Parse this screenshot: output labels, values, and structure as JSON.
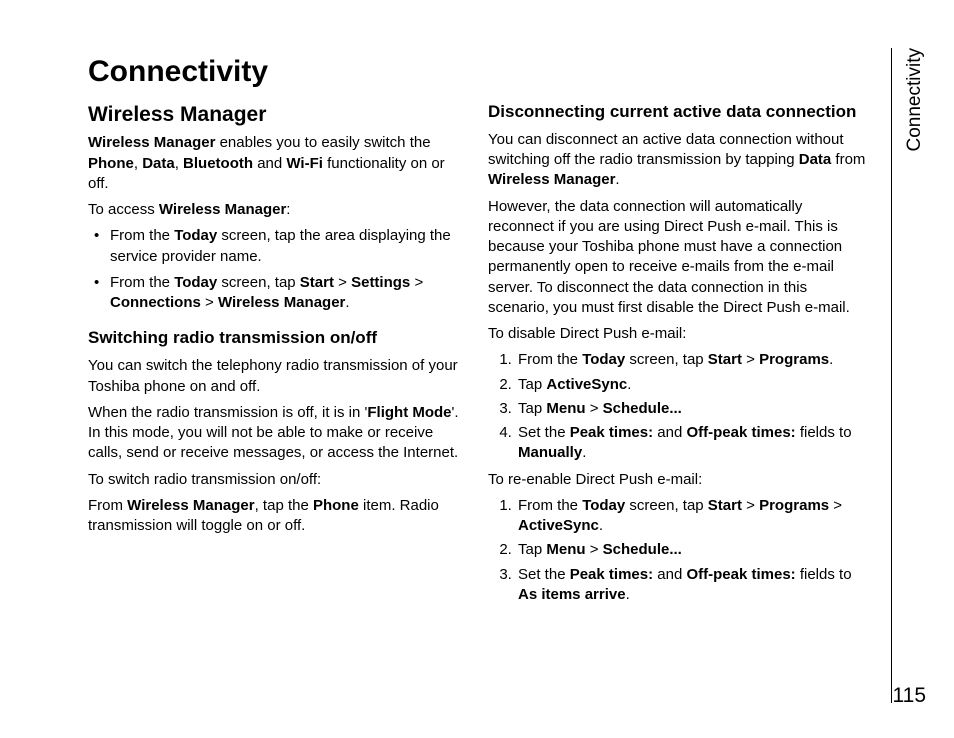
{
  "title": "Connectivity",
  "sideTab": "Connectivity",
  "pageNumber": "115",
  "left": {
    "h2": "Wireless Manager",
    "intro_1a": "Wireless Manager",
    "intro_1b": " enables you to easily switch the ",
    "intro_1c": "Phone",
    "intro_1d": ", ",
    "intro_1e": "Data",
    "intro_1f": ", ",
    "intro_1g": "Bluetooth",
    "intro_1h": " and ",
    "intro_1i": "Wi-Fi",
    "intro_1j": " functionality on or off.",
    "access_1a": "To access ",
    "access_1b": "Wireless Manager",
    "access_1c": ":",
    "bul1_a": "From the ",
    "bul1_b": "Today",
    "bul1_c": " screen, tap the area displaying the service provider name.",
    "bul2_a": "From the ",
    "bul2_b": "Today",
    "bul2_c": " screen, tap ",
    "bul2_d": "Start",
    "bul2_e": " > ",
    "bul2_f": "Settings",
    "bul2_g": " > ",
    "bul2_h": "Connections",
    "bul2_i": " > ",
    "bul2_j": "Wireless Manager",
    "bul2_k": ".",
    "h3a": "Switching radio transmission on/off",
    "p3": "You can switch the telephony radio transmission of your Toshiba phone on and off.",
    "p4a": "When the radio transmission is off, it is in '",
    "p4b": "Flight Mode",
    "p4c": "'. In this mode, you will not be able to make or receive calls, send or receive messages, or access the Internet.",
    "p5": "To switch radio transmission on/off:",
    "p6a": "From ",
    "p6b": "Wireless Manager",
    "p6c": ", tap the ",
    "p6d": "Phone",
    "p6e": " item. Radio transmission will toggle on or off."
  },
  "right": {
    "h3b": "Disconnecting current active data connection",
    "p1a": "You can disconnect an active data connection without switching off the radio transmission by tapping ",
    "p1b": "Data",
    "p1c": " from ",
    "p1d": "Wireless Manager",
    "p1e": ".",
    "p2": "However, the data connection will automatically reconnect if you are using Direct Push e-mail. This is because your Toshiba phone must have a connection permanently open to receive e-mails from the e-mail server. To disconnect the data connection in this scenario, you must first disable the Direct Push e-mail.",
    "p3": "To disable Direct Push e-mail:",
    "d1_a": "From the ",
    "d1_b": "Today",
    "d1_c": " screen, tap ",
    "d1_d": "Start",
    "d1_e": " > ",
    "d1_f": "Programs",
    "d1_g": ".",
    "d2_a": "Tap ",
    "d2_b": "ActiveSync",
    "d2_c": ".",
    "d3_a": "Tap ",
    "d3_b": "Menu",
    "d3_c": " > ",
    "d3_d": "Schedule...",
    "d4_a": "Set the ",
    "d4_b": "Peak times:",
    "d4_c": " and ",
    "d4_d": "Off-peak times:",
    "d4_e": " fields to ",
    "d4_f": "Manually",
    "d4_g": ".",
    "p4": "To re-enable Direct Push e-mail:",
    "r1_a": "From the ",
    "r1_b": "Today",
    "r1_c": " screen, tap ",
    "r1_d": "Start",
    "r1_e": " > ",
    "r1_f": "Programs",
    "r1_g": " > ",
    "r1_h": "ActiveSync",
    "r1_i": ".",
    "r2_a": "Tap ",
    "r2_b": "Menu",
    "r2_c": " > ",
    "r2_d": "Schedule...",
    "r3_a": "Set the ",
    "r3_b": "Peak times:",
    "r3_c": " and ",
    "r3_d": "Off-peak times:",
    "r3_e": " fields to ",
    "r3_f": "As items arrive",
    "r3_g": "."
  }
}
